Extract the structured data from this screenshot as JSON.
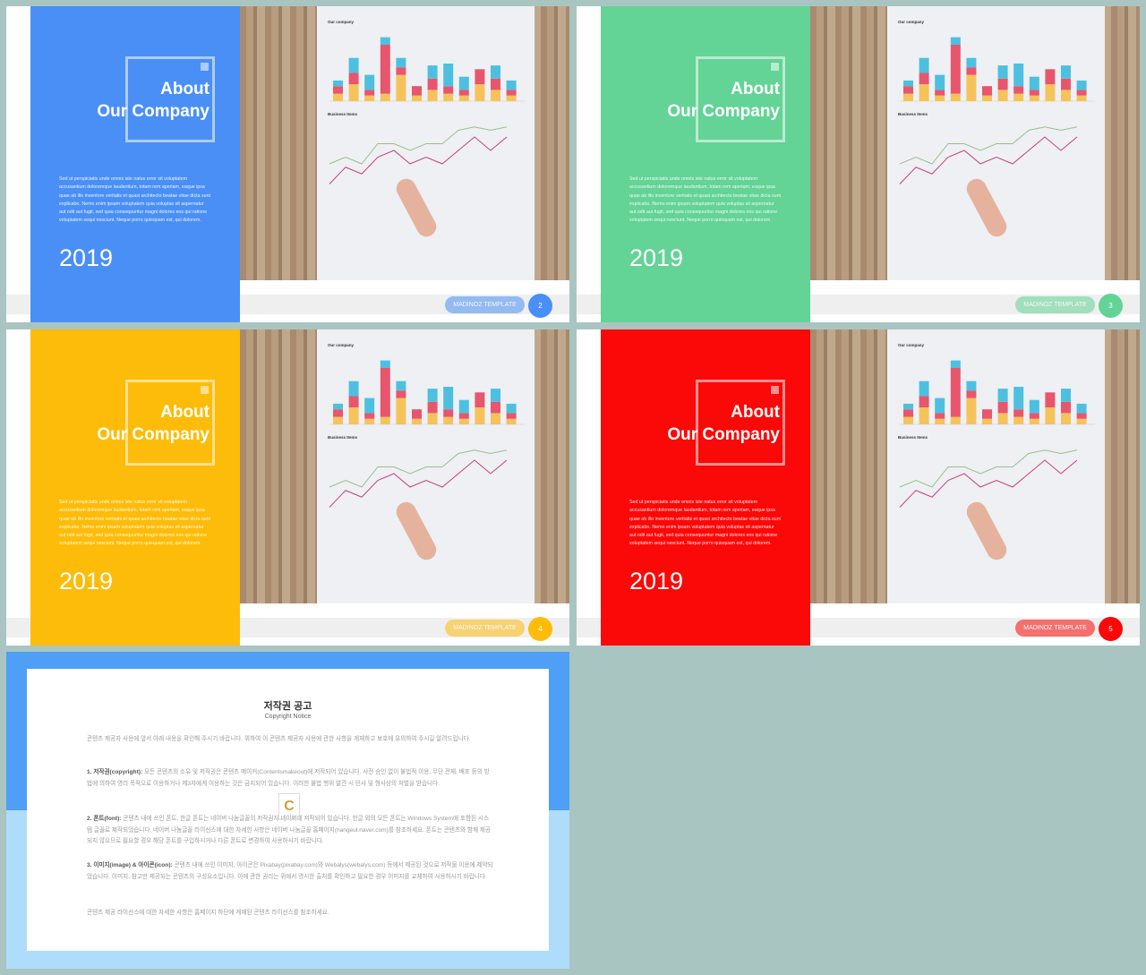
{
  "slides": [
    {
      "color": "#4a8ff5",
      "title_line1": "About",
      "title_line2": "Our Company",
      "body": "Sed ut perspiciatis unde omnis iste natus error sit voluptatem accusantium doloremque laudantium, totam rem aperiam, eaque ipsa quae ab illo inventore veritatis et quasi architecto beatae vitae dicta sunt explicabo. Nemo enim ipsam voluptatem quia voluptas sit aspernatur aut odit aut fugit, sed quia consequuntur magni dolores eos qui ratione voluptatem sequi nesciunt. Neque porro quisquam est, qui dolorem.",
      "year": "2019",
      "footer": "MADINOZ TEMPLATE",
      "page": "2"
    },
    {
      "color": "#63d396",
      "title_line1": "About",
      "title_line2": "Our Company",
      "body": "Sed ut perspiciatis unde omnis iste natus error sit voluptatem accusantium doloremque laudantium, totam rem aperiam, eaque ipsa quae ab illo inventore veritatis et quasi architecto beatae vitae dicta sunt explicabo. Nemo enim ipsam voluptatem quia voluptas sit aspernatur aut odit aut fugit, sed quia consequuntur magni dolores eos qui ratione voluptatem sequi nesciunt. Neque porro quisquam est, qui dolorem.",
      "year": "2019",
      "footer": "MADINOZ TEMPLATE",
      "page": "3"
    },
    {
      "color": "#fdbc0a",
      "title_line1": "About",
      "title_line2": "Our Company",
      "body": "Sed ut perspiciatis unde omnis iste natus error sit voluptatem accusantium doloremque laudantium, totam rem aperiam, eaque ipsa quae ab illo inventore veritatis et quasi architecto beatae vitae dicta sunt explicabo. Nemo enim ipsam voluptatem quia voluptas sit aspernatur aut odit aut fugit, sed quia consequuntur magni dolores eos qui ratione voluptatem sequi nesciunt. Neque porro quisquam est, qui dolorem.",
      "year": "2019",
      "footer": "MADINOZ TEMPLATE",
      "page": "4"
    },
    {
      "color": "#fb0808",
      "title_line1": "About",
      "title_line2": "Our Company",
      "body": "Sed ut perspiciatis unde omnis iste natus error sit voluptatem accusantium doloremque laudantium, totam rem aperiam, eaque ipsa quae ab illo inventore veritatis et quasi architecto beatae vitae dicta sunt explicabo. Nemo enim ipsam voluptatem quia voluptas sit aspernatur aut odit aut fugit, sed quia consequuntur magni dolores eos qui ratione voluptatem sequi nesciunt. Neque porro quisquam est, qui dolorem.",
      "year": "2019",
      "footer": "MADINOZ TEMPLATE",
      "page": "5"
    }
  ],
  "photo": {
    "chart1_title": "Our company",
    "chart2_title": "Business Items",
    "bars": [
      [
        2,
        2,
        1.5
      ],
      [
        4.5,
        3,
        4
      ],
      [
        1.5,
        1.5,
        4
      ],
      [
        2,
        13,
        2
      ],
      [
        7,
        2,
        2.5
      ],
      [
        1.5,
        2.5,
        0
      ],
      [
        3,
        3,
        3.5
      ],
      [
        2,
        2,
        6
      ],
      [
        1.5,
        1.5,
        3.5
      ],
      [
        4.5,
        4,
        0
      ],
      [
        3,
        3,
        3.5
      ],
      [
        1.5,
        1.5,
        2.5
      ]
    ],
    "line_green": [
      4,
      5,
      4,
      7,
      7,
      6,
      7,
      7,
      9,
      9.5,
      9,
      9.5
    ],
    "line_red": [
      1,
      3.5,
      2.5,
      5,
      6,
      4,
      5,
      4,
      6,
      8,
      6,
      8
    ],
    "colors": {
      "yellow": "#f5c35a",
      "red": "#e8566d",
      "blue": "#4dc0e0",
      "green": "#9ac08a",
      "line_red": "#c8407a"
    }
  },
  "notice": {
    "title": "저작권 공고",
    "subtitle": "Copyright Notice",
    "intro": "콘텐츠 제공자 사용에 앞서 아래 내용을 확인해 주시기 바랍니다. 위하여 이 콘텐츠 제공자 사용에 관한 사항을 게재하고 보호에 유의하여 주시길 알려드립니다.",
    "p1_label": "1. 저작권(copyright):",
    "p1": " 모든 콘텐츠의 소유 및 저작권은 콘텐츠 메이커(Contentsmakeout)에 저작되어 있습니다. 사전 승인 없이 불법적 이용, 무단 전재, 배포 등의 방법에 의하여 영리 목적으로 이용하거나 제3자에게 이용하는 것은 금지되어 있습니다. 이러한 불법 행위 발견 시 민사 및 형사상의 처벌을 받습니다.",
    "p2_label": "2. 폰트(font):",
    "p2": " 콘텐츠 내에 쓰인 폰트, 한글 폰트는 네이버 나눔글꼴의 저작권자 네이버에 저작되어 있습니다. 한글 외의 모든 폰트는 Windows System에 포함된 시스템 글꼴로 제작되었습니다. 네이버 나눔글꼴 라이선스에 대한 자세한 사항은 네이버 나눔글꼴 홈페이지(hangeul.naver.com)를 참조하세요. 폰트는 콘텐츠와 함께 제공되지 않으므로 필요할 경우 해당 폰트를 구입하시거나 다른 폰트로 변경하여 사용하시기 바랍니다.",
    "p3_label": "3. 이미지(image) & 아이콘(icon):",
    "p3": " 콘텐츠 내에 쓰인 이미지, 아이콘은 Pixabay(pixabay.com)와 Webalys(webalys.com) 등에서 제공된 것으로 저작물 이용에 제약되었습니다. 이미지, 참고만 제공되는 콘텐츠의 구성요소입니다. 이에 관한 권리는 위에서 명시한 출처를 확인하고 필요한 경우 이미지를 교체하여 사용하시기 바랍니다.",
    "outro": "콘텐츠 제공 라이선스에 대한 자세한 사항은 홈페이지 하단에 게재된 콘텐츠 라이선스를 참조하세요.",
    "logo_letter": "C"
  }
}
